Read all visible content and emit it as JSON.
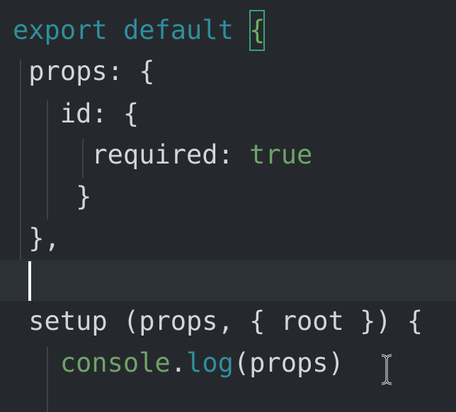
{
  "editor": {
    "lines": [
      {
        "tokens": [
          {
            "text": "export",
            "kind": "kw"
          },
          {
            "text": " ",
            "kind": "plain"
          },
          {
            "text": "default",
            "kind": "kw"
          },
          {
            "text": " ",
            "kind": "plain"
          },
          {
            "text": "{",
            "kind": "bracket-match"
          }
        ]
      },
      {
        "tokens": [
          {
            "text": " props: {",
            "kind": "plain"
          }
        ]
      },
      {
        "tokens": [
          {
            "text": "   id: {",
            "kind": "plain"
          }
        ]
      },
      {
        "tokens": [
          {
            "text": "     required: ",
            "kind": "plain"
          },
          {
            "text": "true",
            "kind": "bool"
          }
        ]
      },
      {
        "tokens": [
          {
            "text": "    }",
            "kind": "plain"
          }
        ]
      },
      {
        "tokens": [
          {
            "text": " },",
            "kind": "plain"
          }
        ]
      },
      {
        "tokens": []
      },
      {
        "tokens": [
          {
            "text": " setup (props, { root }) {",
            "kind": "plain"
          }
        ]
      },
      {
        "tokens": [
          {
            "text": "   ",
            "kind": "plain"
          },
          {
            "text": "console",
            "kind": "obj"
          },
          {
            "text": ".",
            "kind": "plain"
          },
          {
            "text": "log",
            "kind": "fn"
          },
          {
            "text": "(props)",
            "kind": "plain"
          }
        ]
      }
    ],
    "colors": {
      "background": "#25292d",
      "current_line": "#2c3136",
      "keyword": "#2f8f9c",
      "boolean": "#6fa26a",
      "text": "#d3d6d9",
      "bracket_match_outline": "#3aa17a"
    }
  },
  "cursor": {
    "line": 7,
    "column": 1
  },
  "pointer": {
    "icon": "i-beam-cursor-icon"
  }
}
